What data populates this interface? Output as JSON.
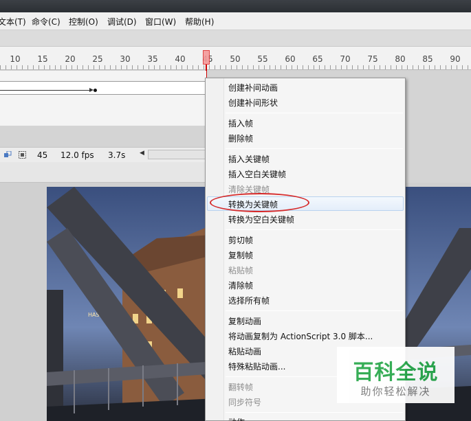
{
  "menubar": {
    "items": [
      "文本(T)",
      "命令(C)",
      "控制(O)",
      "调试(D)",
      "窗口(W)",
      "帮助(H)"
    ]
  },
  "timeline": {
    "ruler_numbers": [
      "10",
      "15",
      "20",
      "25",
      "30",
      "35",
      "40",
      "45",
      "50",
      "55",
      "60",
      "65",
      "70",
      "75",
      "80",
      "85",
      "90"
    ],
    "current_frame": "45",
    "fps": "12.0 fps",
    "elapsed": "3.7s"
  },
  "context_menu": {
    "items": [
      {
        "label": "创建补间动画",
        "enabled": true
      },
      {
        "label": "创建补间形状",
        "enabled": true
      },
      {
        "label": "插入帧",
        "enabled": true
      },
      {
        "label": "删除帧",
        "enabled": true
      },
      {
        "label": "插入关键帧",
        "enabled": true
      },
      {
        "label": "插入空白关键帧",
        "enabled": true
      },
      {
        "label": "清除关键帧",
        "enabled": false
      },
      {
        "label": "转换为关键帧",
        "enabled": true,
        "highlighted": true
      },
      {
        "label": "转换为空白关键帧",
        "enabled": true
      },
      {
        "label": "剪切帧",
        "enabled": true
      },
      {
        "label": "复制帧",
        "enabled": true
      },
      {
        "label": "粘贴帧",
        "enabled": false
      },
      {
        "label": "清除帧",
        "enabled": true
      },
      {
        "label": "选择所有帧",
        "enabled": true
      },
      {
        "label": "复制动画",
        "enabled": true
      },
      {
        "label": "将动画复制为 ActionScript 3.0 脚本...",
        "enabled": true
      },
      {
        "label": "粘贴动画",
        "enabled": true
      },
      {
        "label": "特殊粘贴动画...",
        "enabled": true
      },
      {
        "label": "翻转帧",
        "enabled": false
      },
      {
        "label": "同步符号",
        "enabled": false
      },
      {
        "label": "动作",
        "enabled": true
      }
    ]
  },
  "photo": {
    "sign_text": "HASSENYO"
  },
  "watermark": {
    "title": "百科全说",
    "subtitle": "助你轻松解决"
  },
  "colors": {
    "highlight_circle": "#d62a2a",
    "watermark_green": "#28a84a",
    "playhead": "#f59a9a"
  }
}
